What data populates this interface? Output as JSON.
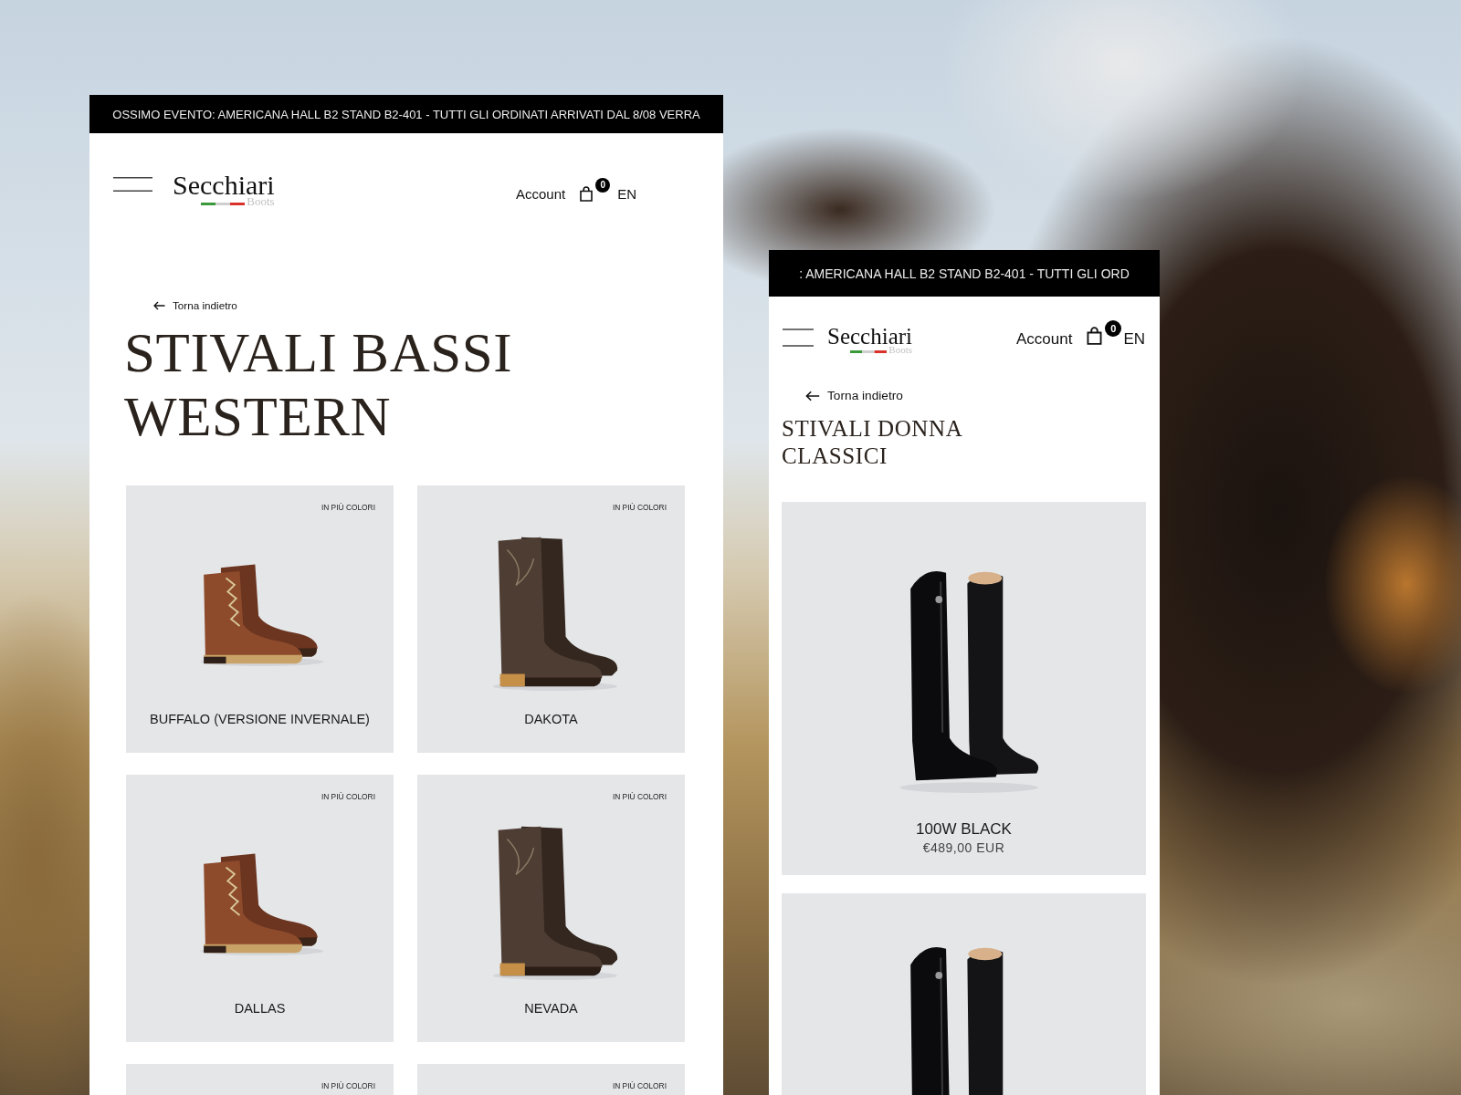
{
  "screens": [
    {
      "announcement": "OSSIMO EVENTO: AMERICANA HALL B2 STAND B2-401 - TUTTI GLI ORDINATI ARRIVATI DAL 8/08 VERRA",
      "header": {
        "logo": "Secchiari",
        "logo_subtitle": "Boots",
        "account": "Account",
        "cart_count": "0",
        "language": "EN"
      },
      "back_link": "Torna indietro",
      "title": "STIVALI BASSI WESTERN",
      "products": [
        {
          "badge": "IN PIÙ COLORI",
          "name": "BUFFALO (VERSIONE INVERNALE)",
          "kind": "lace-up"
        },
        {
          "badge": "IN PIÙ COLORI",
          "name": "DAKOTA",
          "kind": "western"
        },
        {
          "badge": "IN PIÙ COLORI",
          "name": "DALLAS",
          "kind": "lace-up"
        },
        {
          "badge": "IN PIÙ COLORI",
          "name": "NEVADA",
          "kind": "western"
        },
        {
          "badge": "IN PIÙ COLORI"
        },
        {
          "badge": "IN PIÙ COLORI"
        }
      ]
    },
    {
      "announcement": ": AMERICANA HALL B2 STAND B2-401 - TUTTI GLI ORD",
      "header": {
        "logo": "Secchiari",
        "logo_subtitle": "Boots",
        "account": "Account",
        "cart_count": "0",
        "language": "EN"
      },
      "back_link": "Torna indietro",
      "title": "STIVALI DONNA CLASSICI",
      "products": [
        {
          "name": "100W BLACK",
          "price": "€489,00 EUR",
          "kind": "riding"
        },
        {
          "kind": "riding"
        }
      ]
    }
  ]
}
